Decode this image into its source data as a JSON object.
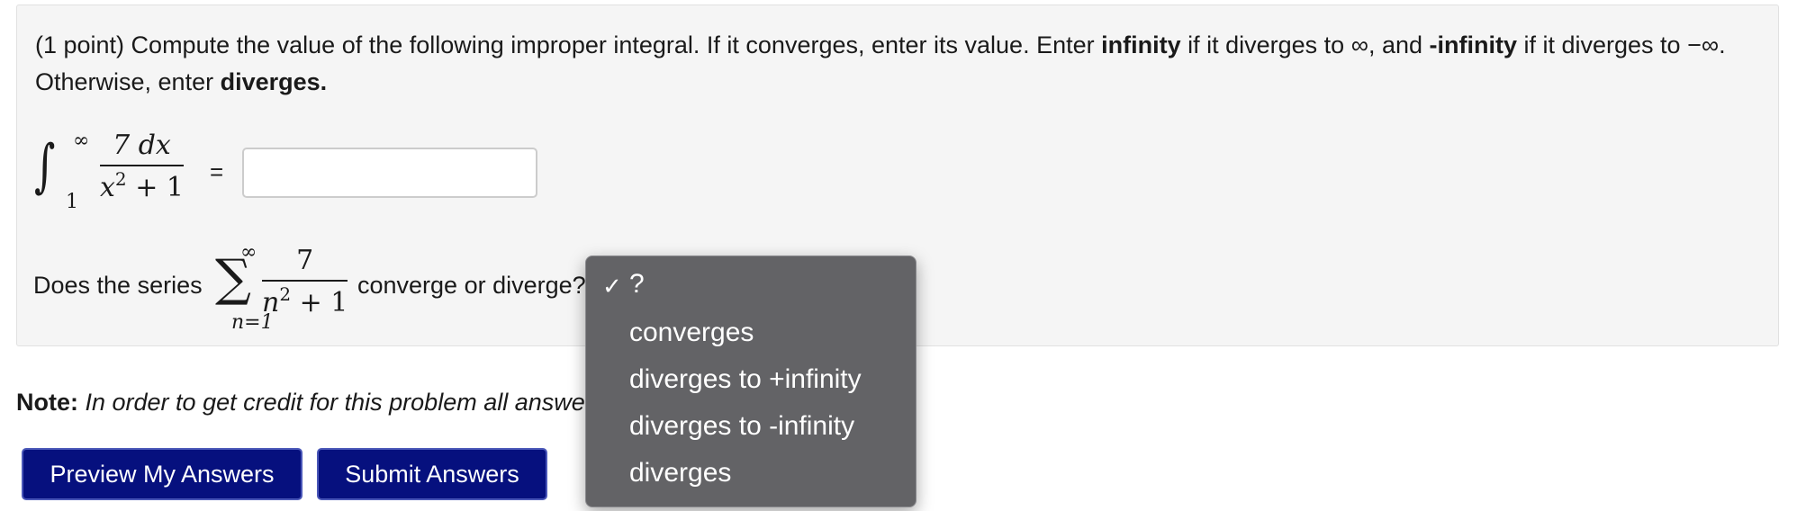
{
  "problem": {
    "prompt_prefix": "(1 point) Compute the value of the following improper integral. If it converges, enter its value. Enter ",
    "bold_infinity": "infinity",
    "mid1": " if it diverges to ∞, and ",
    "bold_neg_infinity": "-infinity",
    "mid2": " if it diverges to −∞. Otherwise, enter ",
    "bold_diverges": "diverges."
  },
  "integral": {
    "upper": "∞",
    "lower": "1",
    "numerator": "7 dx",
    "denominator_base": "x",
    "denominator_exp": "2",
    "denominator_tail": " + 1",
    "equals": "=",
    "answer_value": ""
  },
  "series": {
    "question_prefix": "Does the series",
    "sigma": "∑",
    "upper": "∞",
    "lower": "n=1",
    "numerator": "7",
    "denominator_base": "n",
    "denominator_exp": "2",
    "denominator_tail": " + 1",
    "question_suffix": "converge or diverge?"
  },
  "note": {
    "label": "Note:",
    "text": " In order to get credit for this problem all answers must be correct."
  },
  "buttons": {
    "preview": "Preview My Answers",
    "submit": "Submit Answers"
  },
  "dropdown": {
    "check_icon": "✓",
    "options": [
      "?",
      "converges",
      "diverges to +infinity",
      "diverges to -infinity",
      "diverges"
    ],
    "selected": "?"
  }
}
